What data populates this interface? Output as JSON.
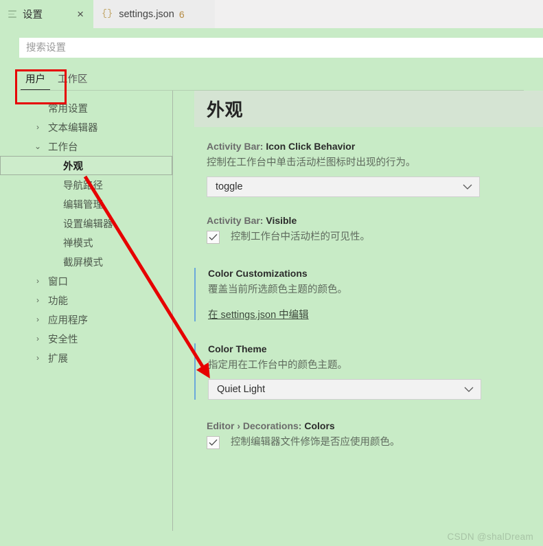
{
  "window": {
    "tabs": [
      {
        "id": "settings",
        "label": "设置",
        "icon": "preferences-icon",
        "active": true,
        "close_glyph": "×"
      },
      {
        "id": "settings-json",
        "label": "settings.json",
        "icon": "json-braces-icon",
        "braces": "{}",
        "badge": "6",
        "active": false
      }
    ]
  },
  "search": {
    "placeholder": "搜索设置",
    "value": ""
  },
  "scope_tabs": [
    {
      "label": "用户",
      "active": true
    },
    {
      "label": "工作区",
      "active": false
    }
  ],
  "sidebar": {
    "items": [
      {
        "label": "常用设置",
        "chevron": "",
        "level": 0,
        "selected": false
      },
      {
        "label": "文本编辑器",
        "chevron": "›",
        "level": 0,
        "selected": false
      },
      {
        "label": "工作台",
        "chevron": "⌄",
        "level": 0,
        "selected": false
      },
      {
        "label": "外观",
        "chevron": "",
        "level": 1,
        "selected": true
      },
      {
        "label": "导航路径",
        "chevron": "",
        "level": 1,
        "selected": false
      },
      {
        "label": "编辑管理",
        "chevron": "",
        "level": 1,
        "selected": false
      },
      {
        "label": "设置编辑器",
        "chevron": "",
        "level": 1,
        "selected": false
      },
      {
        "label": "禅模式",
        "chevron": "",
        "level": 1,
        "selected": false
      },
      {
        "label": "截屏模式",
        "chevron": "",
        "level": 1,
        "selected": false
      },
      {
        "label": "窗口",
        "chevron": "›",
        "level": 0,
        "selected": false
      },
      {
        "label": "功能",
        "chevron": "›",
        "level": 0,
        "selected": false
      },
      {
        "label": "应用程序",
        "chevron": "›",
        "level": 0,
        "selected": false
      },
      {
        "label": "安全性",
        "chevron": "›",
        "level": 0,
        "selected": false
      },
      {
        "label": "扩展",
        "chevron": "›",
        "level": 0,
        "selected": false
      }
    ]
  },
  "main": {
    "section_title": "外观",
    "settings": [
      {
        "id": "activity-bar-icon-click-behavior",
        "prefix": "Activity Bar: ",
        "name": "Icon Click Behavior",
        "description": "控制在工作台中单击活动栏图标时出现的行为。",
        "control": "select",
        "value": "toggle",
        "modified": false
      },
      {
        "id": "activity-bar-visible",
        "prefix": "Activity Bar: ",
        "name": "Visible",
        "description": "控制工作台中活动栏的可见性。",
        "control": "checkbox",
        "checked": true,
        "modified": false
      },
      {
        "id": "color-customizations",
        "prefix": "",
        "name": "Color Customizations",
        "description": "覆盖当前所选颜色主题的颜色。",
        "control": "link",
        "link_label": "在 settings.json 中编辑",
        "modified": true
      },
      {
        "id": "color-theme",
        "prefix": "",
        "name": "Color Theme",
        "description": "指定用在工作台中的颜色主题。",
        "control": "select",
        "value": "Quiet Light",
        "modified": true
      },
      {
        "id": "editor-decorations-colors",
        "prefix": "Editor › Decorations: ",
        "name": "Colors",
        "description": "控制编辑器文件修饰是否应使用颜色。",
        "control": "checkbox",
        "checked": true,
        "modified": false
      }
    ]
  },
  "annotations": {
    "highlight_color": "#e60000",
    "box_target": "用户",
    "arrow_from": "外观",
    "arrow_to": "在 settings.json 中编辑"
  },
  "watermark": "CSDN @shalDream",
  "colors": {
    "background_green": "#c8ebc6",
    "banner_green": "#d5e4d3",
    "tabbar_gray": "#f1f0f0",
    "modified_accent": "#6aa8da",
    "annotation_red": "#e60000"
  }
}
